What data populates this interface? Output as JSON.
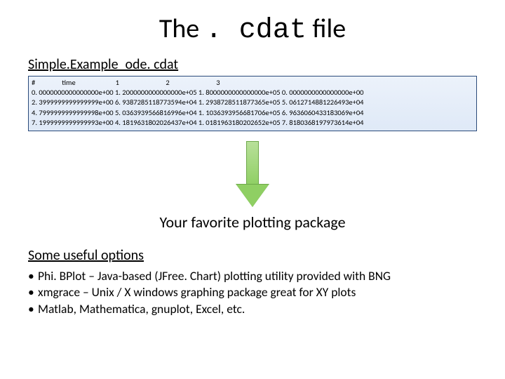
{
  "title_prefix": "The ",
  "title_mono": ". cdat",
  "title_suffix": " file",
  "file_label": "Simple.Example_ode. cdat",
  "file_header": "#                time                        1                            2                            3",
  "file_rows": [
    "0. 0000000000000000e+00 1. 2000000000000000e+05 1. 8000000000000000e+05 0. 0000000000000000e+00",
    "2. 3999999999999999e+00 6. 9387285118773594e+04 1. 2938728511877365e+05 5. 0612714881226493e+04",
    "4. 7999999999999998e+00 5. 0363939566816996e+04 1. 1036393956681706e+05 6. 9636060433183069e+04",
    "7. 1999999999999993e+00 4. 1819631802026437e+04 1. 0181963180202652e+05 7. 8180368197973614e+04"
  ],
  "center_caption": "Your favorite plotting package",
  "options_heading": "Some useful options",
  "bullets": [
    "Phi. BPlot – Java-based (JFree. Chart) plotting utility provided with BNG",
    "xmgrace – Unix / X windows graphing package great for XY plots",
    "Matlab, Mathematica, gnuplot, Excel, etc."
  ]
}
